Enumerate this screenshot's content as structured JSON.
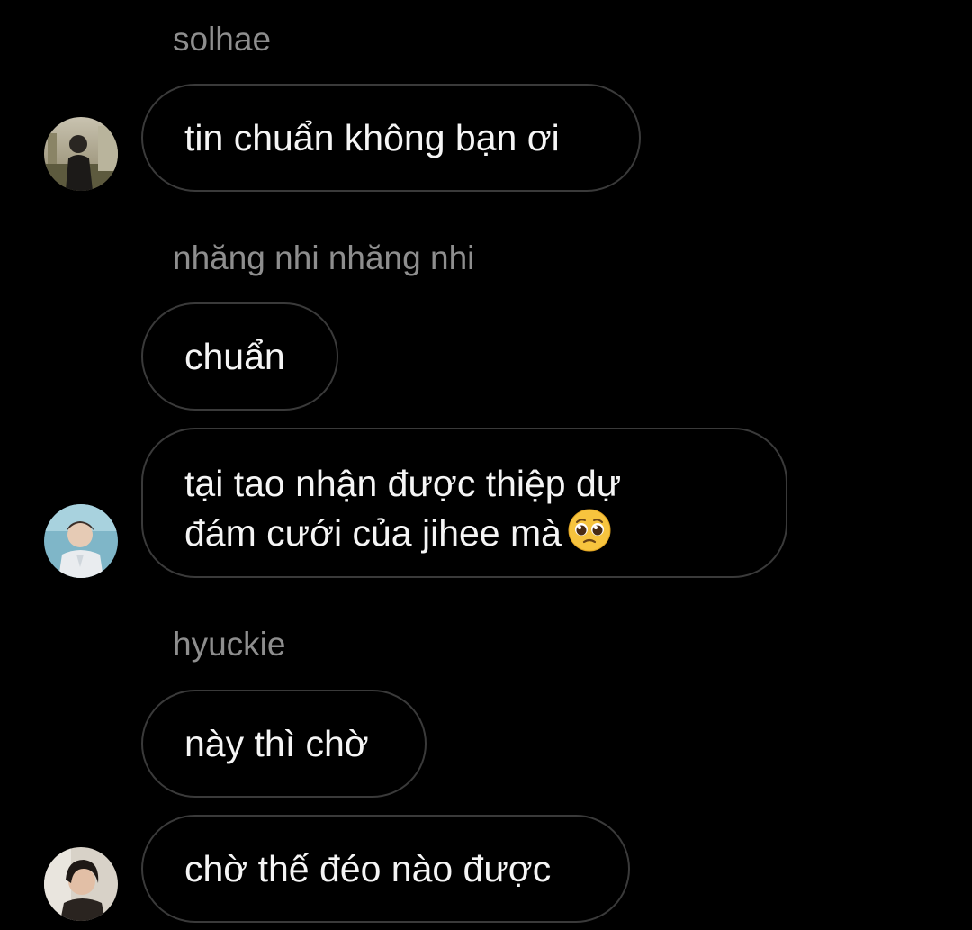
{
  "messages": [
    {
      "sender": "solhae",
      "text": "tin chuẩn không bạn ơi",
      "avatar_icon": "avatar-photo-icon"
    },
    {
      "sender": "nhăng nhi nhăng nhi",
      "text": "chuẩn"
    },
    {
      "text_line1": "tại tao nhận được thiệp dự",
      "text_line2": "đám cưới của jihee mà",
      "emoji": "pleading-face-emoji",
      "avatar_icon": "avatar-photo-icon"
    },
    {
      "sender": "hyuckie",
      "text": "này thì chờ"
    },
    {
      "text": "chờ thế đéo nào được",
      "avatar_icon": "avatar-photo-icon"
    }
  ],
  "colors": {
    "background": "#000000",
    "bubble_border": "#3a3a3a",
    "message_text": "#f5f5f5",
    "sender_text": "#8e8e8e"
  }
}
